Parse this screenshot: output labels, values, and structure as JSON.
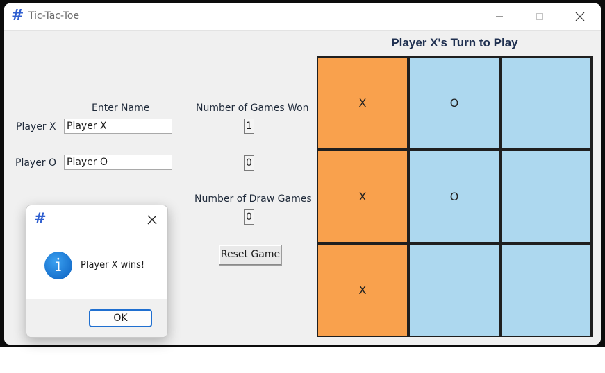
{
  "window": {
    "title": "Tic-Tac-Toe",
    "icon": "hash-icon"
  },
  "form": {
    "enter_name_label": "Enter Name",
    "games_won_label": "Number of Games Won",
    "draw_games_label": "Number of Draw Games",
    "player_x_label": "Player X",
    "player_o_label": "Player O",
    "player_x_name": "Player X",
    "player_o_name": "Player O",
    "player_x_wins": "1",
    "player_o_wins": "0",
    "draw_games": "0",
    "reset_label": "Reset Game"
  },
  "game": {
    "turn_label": "Player X's Turn to Play",
    "board": [
      [
        "X",
        "O",
        ""
      ],
      [
        "X",
        "O",
        ""
      ],
      [
        "X",
        "",
        ""
      ]
    ],
    "highlight": [
      [
        true,
        false,
        false
      ],
      [
        true,
        false,
        false
      ],
      [
        true,
        false,
        false
      ]
    ],
    "colors": {
      "win_cell": "#f9a14d",
      "cell": "#add8ef",
      "grid": "#1f1f1f"
    }
  },
  "dialog": {
    "icon": "hash-icon",
    "message_icon": "info-icon",
    "message": "Player X wins!",
    "ok_label": "OK"
  }
}
